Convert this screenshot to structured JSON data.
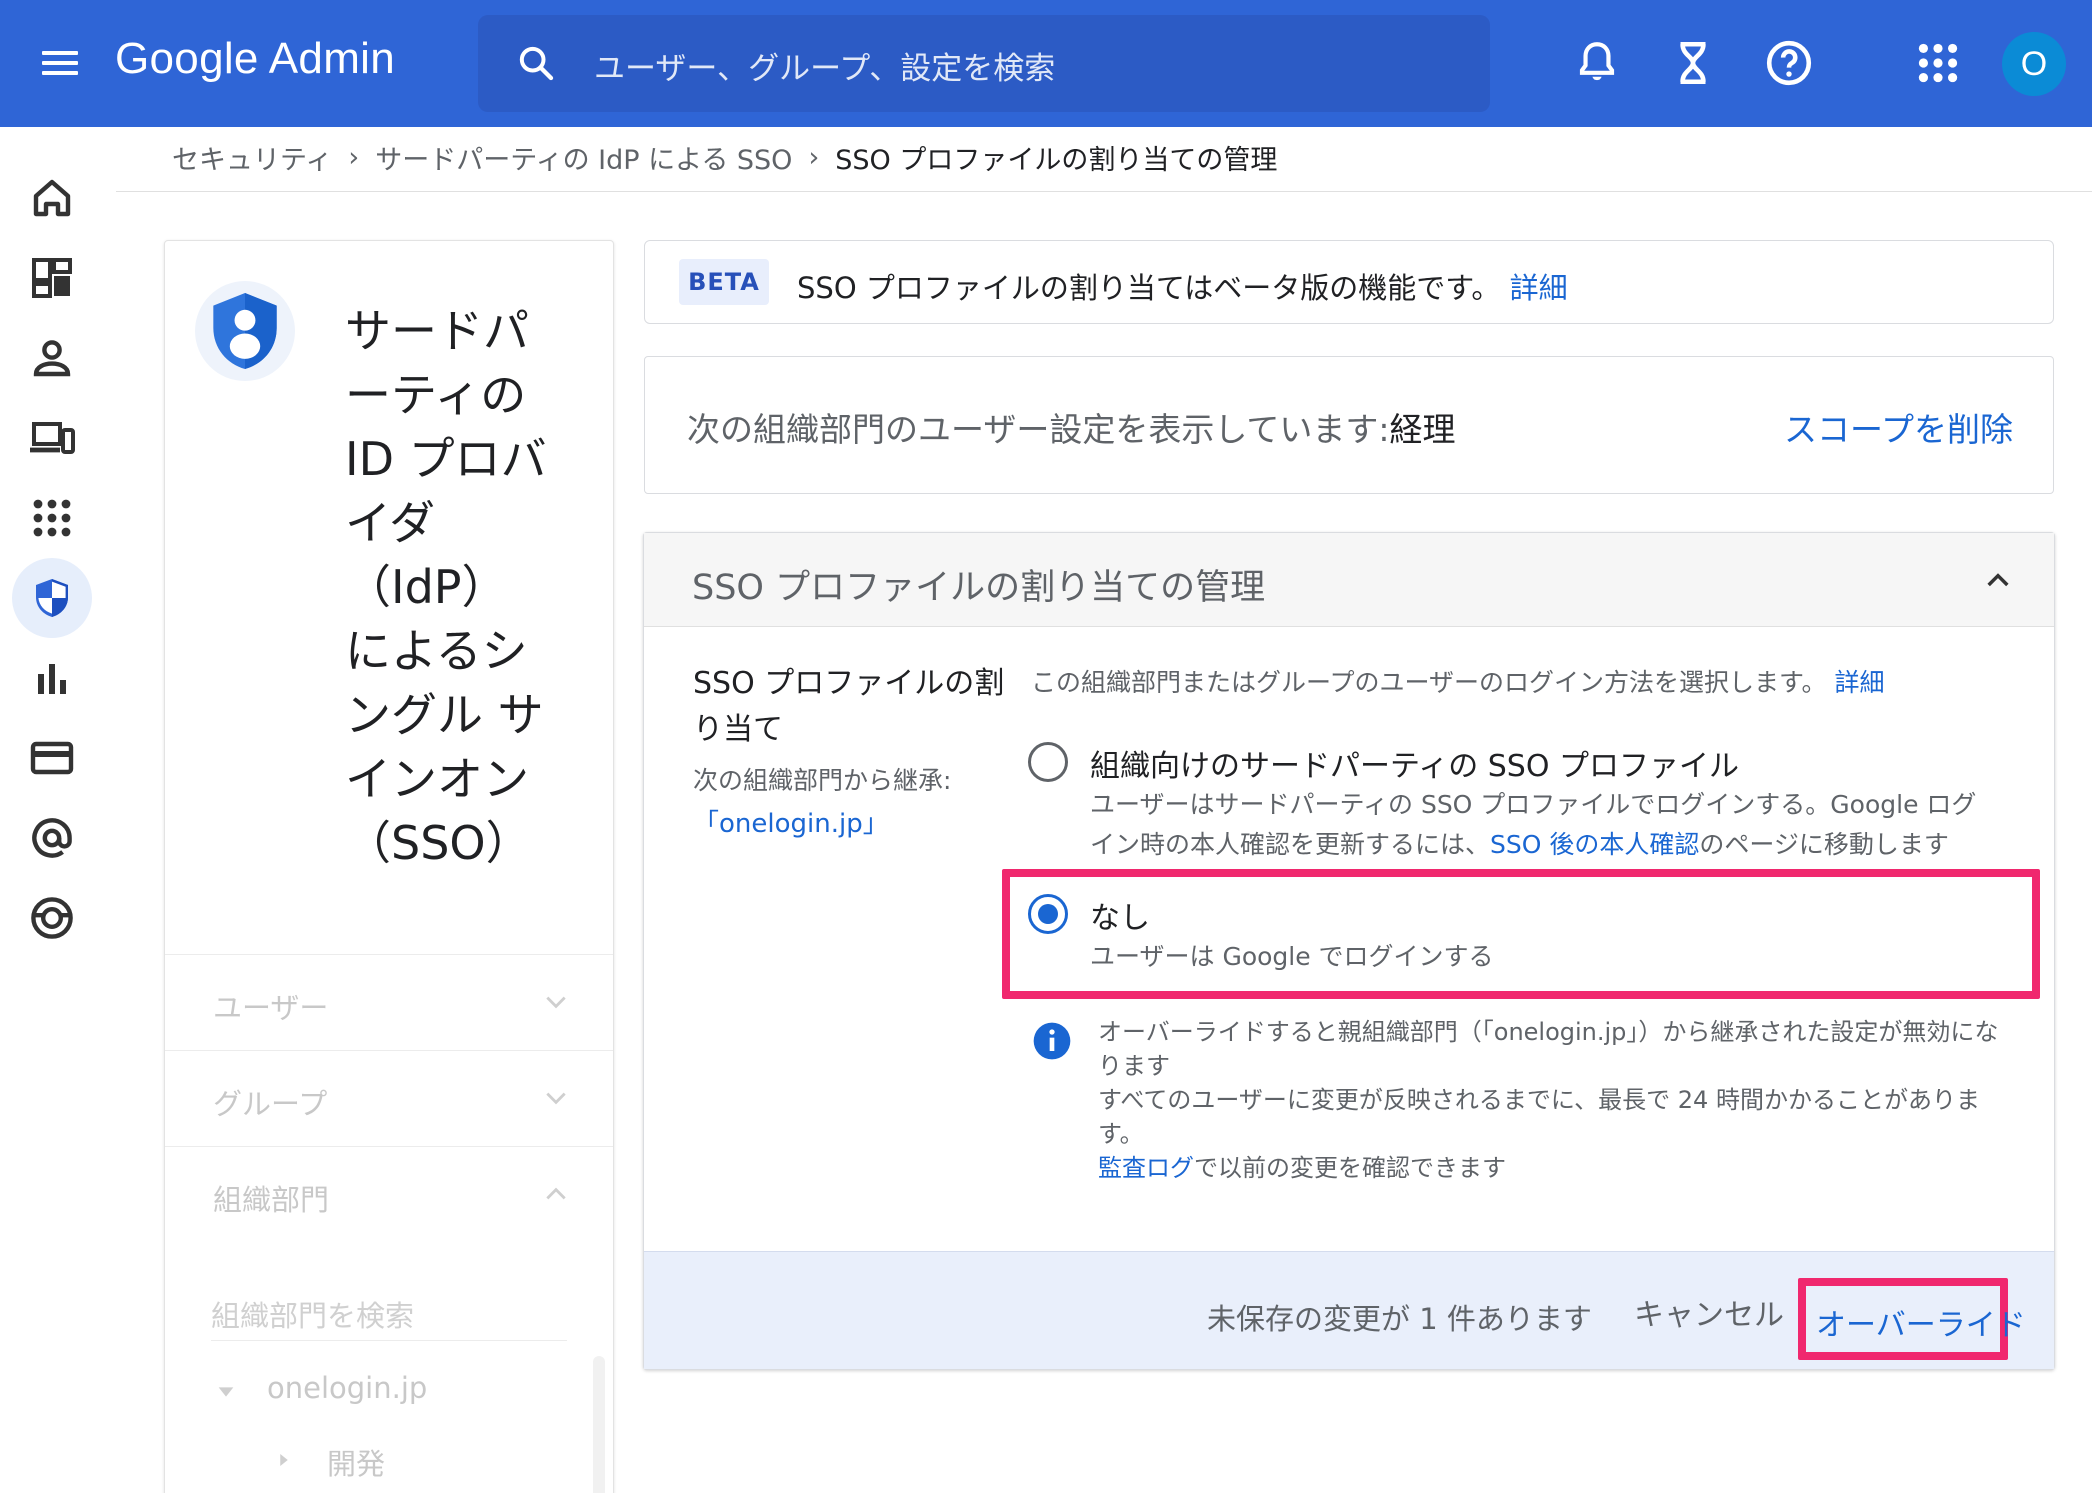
{
  "topbar": {
    "app_name": "Google Admin",
    "search_placeholder": "ユーザー、グループ、設定を検索",
    "avatar_initial": "O"
  },
  "breadcrumb": {
    "items": [
      "セキュリティ",
      "サードパーティの IdP による SSO",
      "SSO プロファイルの割り当ての管理"
    ]
  },
  "left_panel": {
    "title": "サードパーティの ID プロバイダ（IdP）によるシングル サインオン（SSO）",
    "title_lines": [
      "サードパ",
      "ーティの",
      "ID プロバ",
      "イダ",
      "（IdP）",
      "によるシ",
      "ングル サ",
      "インオン",
      "（SSO）"
    ],
    "sections": [
      {
        "label": "ユーザー",
        "expanded": false
      },
      {
        "label": "グループ",
        "expanded": false
      },
      {
        "label": "組織部門",
        "expanded": true
      }
    ],
    "org_search_placeholder": "組織部門を検索",
    "tree": [
      {
        "label": "onelogin.jp",
        "expanded": true
      },
      {
        "label": "開発",
        "expanded": false
      }
    ]
  },
  "beta_notice": {
    "badge": "BETA",
    "text": "SSO プロファイルの割り当てはベータ版の機能です。",
    "link": "詳細"
  },
  "scope": {
    "prefix": "次の組織部門のユーザー設定を表示しています:",
    "org_name": "経理",
    "remove_label": "スコープを削除"
  },
  "card": {
    "title": "SSO プロファイルの割り当ての管理",
    "setting_label": "SSO プロファイルの割り当て",
    "inherit_label": "次の組織部門から継承:",
    "inherit_value": "「onelogin.jp」",
    "description": "この組織部門またはグループのユーザーのログイン方法を選択します。",
    "description_link": "詳細",
    "options": [
      {
        "title": "組織向けのサードパーティの SSO プロファイル",
        "desc_before": "ユーザーはサードパーティの SSO プロファイルでログインする。Google ログイン時の本人確認を更新するには、",
        "desc_link": "SSO 後の本人確認",
        "desc_after": "のページに移動します",
        "selected": false
      },
      {
        "title": "なし",
        "desc": "ユーザーは Google でログインする",
        "selected": true
      }
    ],
    "info": {
      "line1": "オーバーライドすると親組織部門（「onelogin.jp」）から継承された設定が無効になります",
      "line2": "すべてのユーザーに変更が反映されるまでに、最長で 24 時間かかることがあります。",
      "link": "監査ログ",
      "line3_after": "で以前の変更を確認できます"
    },
    "footer": {
      "unsaved": "未保存の変更が 1 件あります",
      "cancel": "キャンセル",
      "override": "オーバーライド"
    }
  },
  "colors": {
    "topbar": "#2f65d6",
    "link": "#1a66d2",
    "highlight": "#f0286e",
    "footer_bg": "#e9effb"
  },
  "icons": {
    "topbar": [
      "menu-icon",
      "search-icon",
      "bell-icon",
      "hourglass-icon",
      "help-icon",
      "apps-grid-icon"
    ],
    "rail": [
      "home-icon",
      "dashboard-icon",
      "user-icon",
      "devices-icon",
      "apps-icon",
      "security-shield-icon",
      "reports-icon",
      "billing-icon",
      "email-at-icon",
      "support-icon"
    ]
  }
}
